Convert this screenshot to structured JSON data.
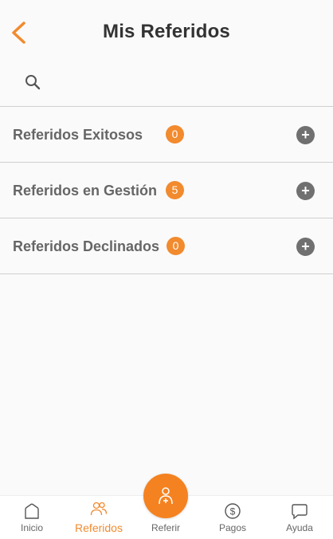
{
  "header": {
    "title": "Mis Referidos",
    "back_icon": "chevron-left-icon"
  },
  "search": {
    "placeholder": "",
    "value": "",
    "icon": "search-icon"
  },
  "categories": [
    {
      "label": "Referidos Exitosos",
      "count": "0"
    },
    {
      "label": "Referidos en Gestión",
      "count": "5"
    },
    {
      "label": "Referidos Declinados",
      "count": "0"
    }
  ],
  "bottom_nav": {
    "items": [
      {
        "label": "Inicio",
        "icon": "home-icon"
      },
      {
        "label": "Referidos",
        "icon": "users-icon",
        "active": true
      },
      {
        "label": "Referir",
        "icon": "add-user-icon"
      },
      {
        "label": "Pagos",
        "icon": "dollar-icon"
      },
      {
        "label": "Ayuda",
        "icon": "chat-icon"
      }
    ]
  },
  "colors": {
    "accent": "#f28a2e",
    "plus_button": "#707070",
    "divider": "#cfcfcf",
    "background": "#fafafa"
  }
}
